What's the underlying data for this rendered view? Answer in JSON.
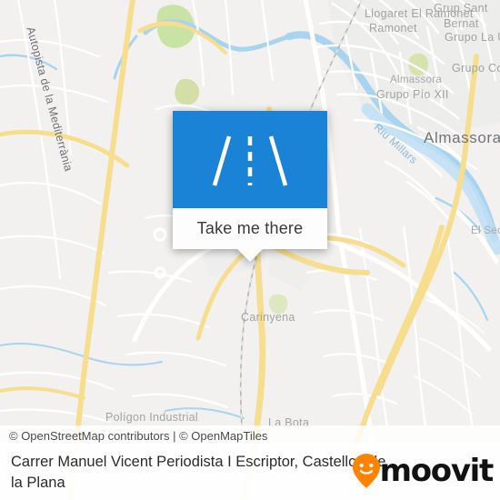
{
  "map": {
    "background_color": "#f2f1ef",
    "water_color": "#a8d4ef",
    "park_color": "#c9e3a5",
    "motorway_color": "#f7de8f",
    "street_color": "#ffffff",
    "labels": {
      "city_almassora": "Almassora",
      "road_autopista": "Autopista de la Mediterrània",
      "river_millars": "Riu Millars",
      "llogaret_el_ramonet": "Llogaret El Ramonet",
      "grup_sant_bernat": "Grup Sant Bernat",
      "grupo_la_u": "Grupo La U",
      "grupo_corell": "Grupo Corell",
      "almassora_small": "Almassora",
      "grupo_pio_xii": "Grupo Pío XII",
      "el_sec": "El Sec",
      "carinyena": "Carinyena",
      "la_bota": "La Bota",
      "poligon_industrial": "Polígon Industrial"
    }
  },
  "callout": {
    "icon": "road-icon",
    "image_background": "#1b83d5",
    "button_label": "Take me there"
  },
  "attribution": {
    "text": "© OpenStreetMap contributors | © OpenMapTiles"
  },
  "footer": {
    "title": "Carrer Manuel Vicent Periodista I Escriptor, Castellon de la Plana",
    "brand": {
      "name": "moovit",
      "pin_icon": "moovit-smiley-pin-icon",
      "pin_color": "#ff8300"
    }
  }
}
